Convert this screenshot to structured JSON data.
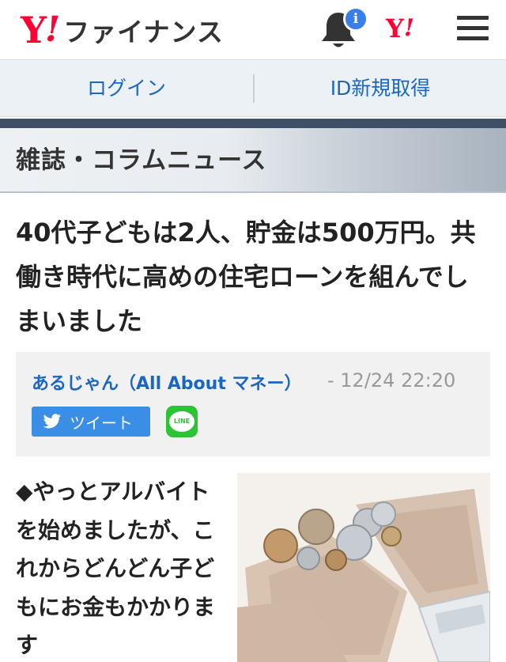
{
  "header": {
    "logo_y": "Y",
    "logo_bang": "!",
    "logo_text": "ファイナンス",
    "notification_badge": "i",
    "yahoo_mini_y": "Y",
    "yahoo_mini_bang": "!",
    "icons": [
      "bell-icon",
      "yahoo-logo-icon",
      "hamburger-menu-icon"
    ]
  },
  "auth": {
    "login_label": "ログイン",
    "register_label": "ID新規取得"
  },
  "section": {
    "title": "雑誌・コラムニュース"
  },
  "article": {
    "title": "40代子どもは2人、貯金は500万円。共働き時代に高めの住宅ローンを組んでしまいました",
    "source": "あるじゃん（All About マネー）",
    "date": "- 12/24 22:20",
    "tweet_label": "ツイート",
    "line_label": "LINE",
    "lead": "◆やっとアルバイトを始めましたが、これからどんどん子どもにお金もかかります"
  },
  "colors": {
    "brand_red": "#ff0033",
    "link_blue": "#1a66c2",
    "twitter_blue": "#3a8ee6",
    "line_green": "#2cc434",
    "badge_blue": "#3a7ee8"
  }
}
